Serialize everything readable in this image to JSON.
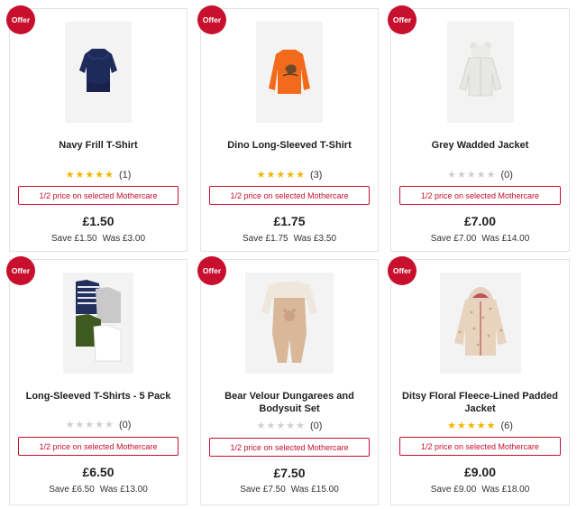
{
  "offer_label": "Offer",
  "colors": {
    "accent": "#c8102e",
    "star_on": "#f2b600",
    "star_off": "#cfcfcf"
  },
  "products": [
    {
      "title": "Navy Frill T-Shirt",
      "rating": 5,
      "reviews": "(1)",
      "promo": "1/2 price on selected Mothercare",
      "price": "£1.50",
      "save": "Save £1.50",
      "was": "Was £3.00",
      "image": "navy-frill-t-shirt"
    },
    {
      "title": "Dino Long-Sleeved T-Shirt",
      "rating": 5,
      "reviews": "(3)",
      "promo": "1/2 price on selected Mothercare",
      "price": "£1.75",
      "save": "Save £1.75",
      "was": "Was £3.50",
      "image": "orange-dino-long-sleeve-tee"
    },
    {
      "title": "Grey Wadded Jacket",
      "rating": 0,
      "reviews": "(0)",
      "promo": "1/2 price on selected Mothercare",
      "price": "£7.00",
      "save": "Save £7.00",
      "was": "Was £14.00",
      "image": "grey-wadded-jacket-with-ears"
    },
    {
      "title": "Long-Sleeved T-Shirts - 5 Pack",
      "rating": 0,
      "reviews": "(0)",
      "promo": "1/2 price on selected Mothercare",
      "price": "£6.50",
      "save": "Save £6.50",
      "was": "Was £13.00",
      "image": "five-pack-tees"
    },
    {
      "title": "Bear Velour Dungarees and Bodysuit Set",
      "rating": 0,
      "reviews": "(0)",
      "promo": "1/2 price on selected Mothercare",
      "price": "£7.50",
      "save": "Save £7.50",
      "was": "Was £15.00",
      "image": "bear-velour-dungarees"
    },
    {
      "title": "Ditsy Floral Fleece-Lined Padded Jacket",
      "rating": 5,
      "reviews": "(6)",
      "promo": "1/2 price on selected Mothercare",
      "price": "£9.00",
      "save": "Save £9.00",
      "was": "Was £18.00",
      "image": "floral-padded-jacket"
    }
  ]
}
